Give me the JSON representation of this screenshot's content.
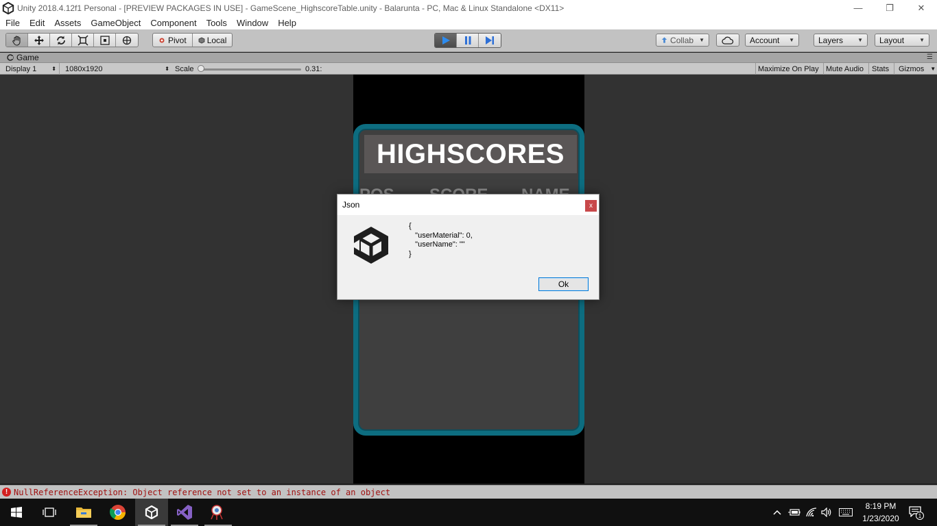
{
  "window": {
    "title": "Unity 2018.4.12f1 Personal - [PREVIEW PACKAGES IN USE] - GameScene_HighscoreTable.unity - Balarunta - PC, Mac & Linux Standalone <DX11>",
    "minimize_glyph": "—",
    "maximize_glyph": "❐",
    "close_glyph": "✕"
  },
  "menu": [
    "File",
    "Edit",
    "Assets",
    "GameObject",
    "Component",
    "Tools",
    "Window",
    "Help"
  ],
  "toolbar": {
    "pivot_label": "Pivot",
    "local_label": "Local",
    "collab_label": "Collab",
    "account_label": "Account",
    "layers_label": "Layers",
    "layout_label": "Layout"
  },
  "game_view": {
    "tab_label": "Game",
    "display_label": "Display 1",
    "resolution_label": "1080x1920",
    "scale_label": "Scale",
    "scale_value": "0.31:",
    "scale_slider_fraction": 0.0,
    "maximize_label": "Maximize On Play",
    "mute_label": "Mute Audio",
    "stats_label": "Stats",
    "gizmos_label": "Gizmos"
  },
  "game": {
    "highscores_title": "HIGHSCORES",
    "col_pos": "POS",
    "col_score": "SCORE",
    "col_name": "NAME"
  },
  "dialog": {
    "title": "Json",
    "close_label": "x",
    "message": "{\n   \"userMaterial\": 0,\n   \"userName\": \"\"\n}",
    "ok_label": "Ok"
  },
  "status": {
    "error_text": "NullReferenceException: Object reference not set to an instance of an object"
  },
  "taskbar": {
    "time": "8:19 PM",
    "date": "1/23/2020",
    "notification_count": "1"
  },
  "colors": {
    "panel_border": "#0d6d80",
    "play_active": "#2d8cf0",
    "error_red": "#d32020"
  }
}
